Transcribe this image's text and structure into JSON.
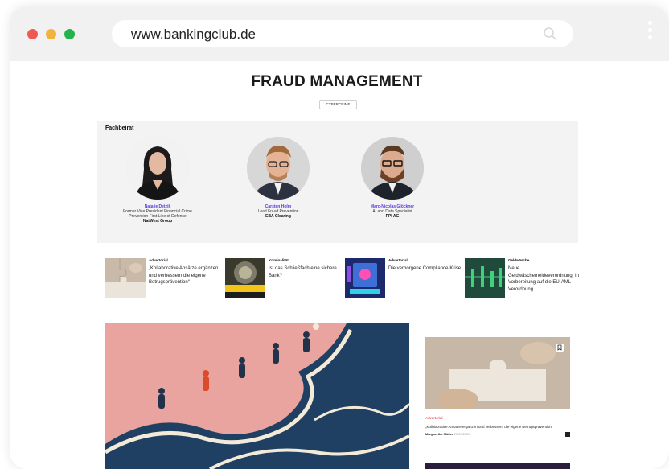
{
  "browser": {
    "url": "www.bankingclub.de",
    "search_icon": "search-icon",
    "menu_icon": "kebab-menu-icon"
  },
  "page": {
    "title": "FRAUD MANAGEMENT",
    "tag": "CYBERCRIME"
  },
  "board": {
    "title": "Fachbeirat",
    "members": [
      {
        "name": "Natalie Detzik",
        "role_line1": "Former Vice President Financial Crime",
        "role_line2": "Prevention First Line of Defense",
        "org": "NatWest Group"
      },
      {
        "name": "Carsten Holm",
        "role_line1": "Lead Fraud Prevention",
        "role_line2": "",
        "org": "EBA Clearing"
      },
      {
        "name": "Marc-Nicolas Glöckner",
        "role_line1": "AI and Data Specialist",
        "role_line2": "",
        "org": "PPI AG"
      }
    ]
  },
  "articles": [
    {
      "category": "Advertorial",
      "title": "„Kollaborative Ansätze ergänzen und verbessern die eigene Betrugsprävention“"
    },
    {
      "category": "Kriminalität",
      "title": "Ist das Schließfach eine sichere Bank?"
    },
    {
      "category": "Advertorial",
      "title": "Die verborgene Compliance-Krise"
    },
    {
      "category": "Geldwäsche",
      "title": "Neue Geldwäschemeldeverordnung: In Vorbereitung auf die EU-AML-Verordnung"
    }
  ],
  "featured_card": {
    "category": "Advertorial",
    "title": "„Kollaborative Ansätze ergänzen und verbessern die eigene Betrugsprävention“",
    "author": "Margarethe Müller",
    "date": "20/03/2025"
  },
  "colors": {
    "accent_purple": "#5a3bd8",
    "accent_red": "#e02424",
    "hero_bg": "#e9a4a0",
    "wave": "#1f3f63"
  }
}
